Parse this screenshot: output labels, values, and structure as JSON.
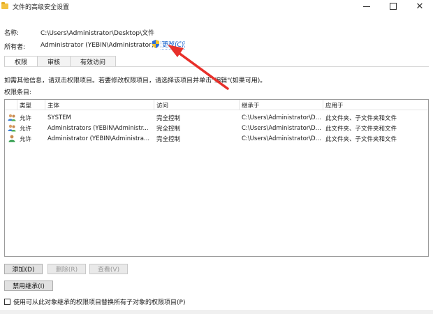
{
  "window": {
    "title": "文件的高级安全设置",
    "minimize": "",
    "maximize": "",
    "close": "✕"
  },
  "name_row": {
    "label": "名称:",
    "value": "C:\\Users\\Administrator\\Desktop\\文件"
  },
  "owner_row": {
    "label": "所有者:",
    "value": "Administrator (YEBIN\\Administrator)",
    "change_link": "更改(C)"
  },
  "tabs": [
    {
      "label": "权限",
      "active": true
    },
    {
      "label": "审核",
      "active": false
    },
    {
      "label": "有效访问",
      "active": false
    }
  ],
  "info_text": "如需其他信息，请双击权限项目。若要修改权限项目，请选择该项目并单击\"编辑\"(如果可用)。",
  "permissions_label": "权限条目:",
  "table": {
    "headers": {
      "type": "类型",
      "principal": "主体",
      "access": "访问",
      "inherited": "继承于",
      "applies": "应用于"
    },
    "rows": [
      {
        "icon": "group-icon",
        "type": "允许",
        "principal": "SYSTEM",
        "access": "完全控制",
        "inherited": "C:\\Users\\Administrator\\D...",
        "applies": "此文件夹、子文件夹和文件"
      },
      {
        "icon": "group-icon",
        "type": "允许",
        "principal": "Administrators (YEBIN\\Administr...",
        "access": "完全控制",
        "inherited": "C:\\Users\\Administrator\\D...",
        "applies": "此文件夹、子文件夹和文件"
      },
      {
        "icon": "user-icon",
        "type": "允许",
        "principal": "Administrator (YEBIN\\Administra...",
        "access": "完全控制",
        "inherited": "C:\\Users\\Administrator\\D...",
        "applies": "此文件夹、子文件夹和文件"
      }
    ]
  },
  "buttons": {
    "add": "添加(D)",
    "remove": "删除(R)",
    "view": "查看(V)",
    "disable_inheritance": "禁用继承(I)"
  },
  "checkbox": {
    "label": "使用可从此对象继承的权限项目替换所有子对象的权限项目(P)",
    "checked": false
  },
  "colors": {
    "link": "#0a58ca",
    "arrow": "#e8302a",
    "border": "#9b9b9b"
  }
}
